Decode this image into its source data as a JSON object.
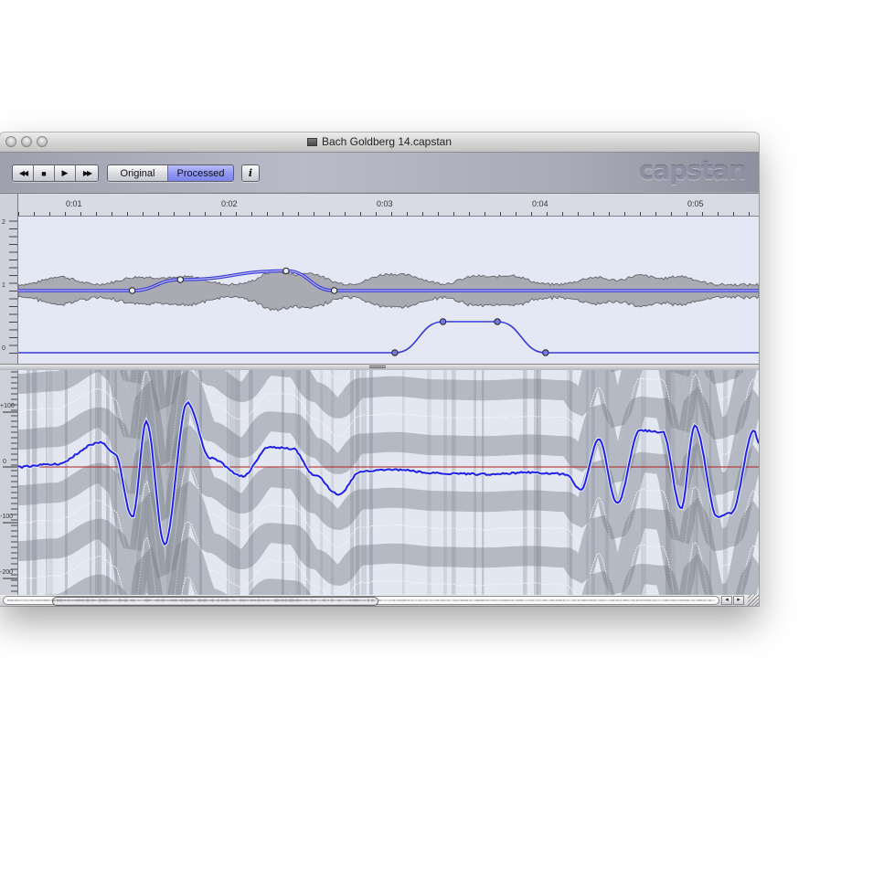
{
  "window": {
    "title": "Bach Goldberg 14.capstan",
    "traffic_lights": [
      "close",
      "minimize",
      "zoom"
    ]
  },
  "toolbar": {
    "transport": [
      {
        "name": "rewind",
        "glyph": "◀◀"
      },
      {
        "name": "stop",
        "glyph": "■"
      },
      {
        "name": "play",
        "glyph": "▶"
      },
      {
        "name": "fast-forward",
        "glyph": "▶▶"
      }
    ],
    "mode_toggle": {
      "options": [
        "Original",
        "Processed"
      ],
      "selected": "Processed"
    },
    "info_label": "i",
    "logo": "capstan"
  },
  "ruler": {
    "labels": [
      "0:01",
      "0:02",
      "0:03",
      "0:04",
      "0:05"
    ]
  },
  "envelope_pane": {
    "y_axis_labels": [
      "2",
      "1",
      "0"
    ],
    "upper_curve_points": [
      {
        "time": "0:01.38",
        "value": 1.0
      },
      {
        "time": "0:01.69",
        "value": 1.25
      },
      {
        "time": "0:02.37",
        "value": 1.45
      },
      {
        "time": "0:02.68",
        "value": 1.0
      }
    ],
    "lower_curve_points": [
      {
        "time": "0:03.07",
        "value": 0.0
      },
      {
        "time": "0:03.38",
        "value": 0.5
      },
      {
        "time": "0:03.73",
        "value": 0.5
      },
      {
        "time": "0:04.04",
        "value": 0.0
      }
    ],
    "colors": {
      "curve": "#3a3ad8",
      "waveform": "#a9aab2",
      "background": "#e4e8f4"
    }
  },
  "pitch_pane": {
    "y_axis_labels": [
      "+100",
      "0",
      "-100",
      "-200"
    ],
    "colors": {
      "pitch_curve": "#2020e8",
      "zero_line": "#b02020"
    }
  },
  "scrollbar": {
    "left_arrow": "◂",
    "right_arrow": "▸"
  }
}
